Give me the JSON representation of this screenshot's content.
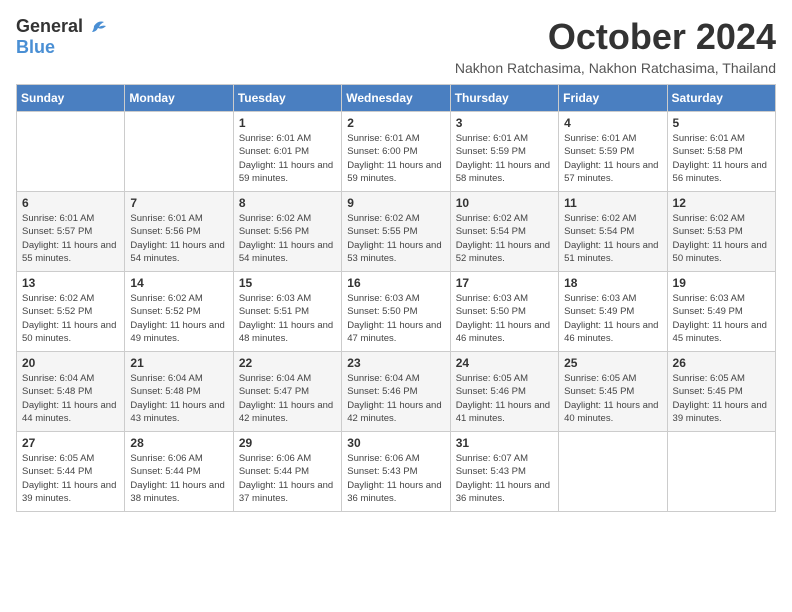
{
  "header": {
    "logo_general": "General",
    "logo_blue": "Blue",
    "month_title": "October 2024",
    "subtitle": "Nakhon Ratchasima, Nakhon Ratchasima, Thailand"
  },
  "weekdays": [
    "Sunday",
    "Monday",
    "Tuesday",
    "Wednesday",
    "Thursday",
    "Friday",
    "Saturday"
  ],
  "weeks": [
    [
      {
        "day": "",
        "info": ""
      },
      {
        "day": "",
        "info": ""
      },
      {
        "day": "1",
        "info": "Sunrise: 6:01 AM\nSunset: 6:01 PM\nDaylight: 11 hours and 59 minutes."
      },
      {
        "day": "2",
        "info": "Sunrise: 6:01 AM\nSunset: 6:00 PM\nDaylight: 11 hours and 59 minutes."
      },
      {
        "day": "3",
        "info": "Sunrise: 6:01 AM\nSunset: 5:59 PM\nDaylight: 11 hours and 58 minutes."
      },
      {
        "day": "4",
        "info": "Sunrise: 6:01 AM\nSunset: 5:59 PM\nDaylight: 11 hours and 57 minutes."
      },
      {
        "day": "5",
        "info": "Sunrise: 6:01 AM\nSunset: 5:58 PM\nDaylight: 11 hours and 56 minutes."
      }
    ],
    [
      {
        "day": "6",
        "info": "Sunrise: 6:01 AM\nSunset: 5:57 PM\nDaylight: 11 hours and 55 minutes."
      },
      {
        "day": "7",
        "info": "Sunrise: 6:01 AM\nSunset: 5:56 PM\nDaylight: 11 hours and 54 minutes."
      },
      {
        "day": "8",
        "info": "Sunrise: 6:02 AM\nSunset: 5:56 PM\nDaylight: 11 hours and 54 minutes."
      },
      {
        "day": "9",
        "info": "Sunrise: 6:02 AM\nSunset: 5:55 PM\nDaylight: 11 hours and 53 minutes."
      },
      {
        "day": "10",
        "info": "Sunrise: 6:02 AM\nSunset: 5:54 PM\nDaylight: 11 hours and 52 minutes."
      },
      {
        "day": "11",
        "info": "Sunrise: 6:02 AM\nSunset: 5:54 PM\nDaylight: 11 hours and 51 minutes."
      },
      {
        "day": "12",
        "info": "Sunrise: 6:02 AM\nSunset: 5:53 PM\nDaylight: 11 hours and 50 minutes."
      }
    ],
    [
      {
        "day": "13",
        "info": "Sunrise: 6:02 AM\nSunset: 5:52 PM\nDaylight: 11 hours and 50 minutes."
      },
      {
        "day": "14",
        "info": "Sunrise: 6:02 AM\nSunset: 5:52 PM\nDaylight: 11 hours and 49 minutes."
      },
      {
        "day": "15",
        "info": "Sunrise: 6:03 AM\nSunset: 5:51 PM\nDaylight: 11 hours and 48 minutes."
      },
      {
        "day": "16",
        "info": "Sunrise: 6:03 AM\nSunset: 5:50 PM\nDaylight: 11 hours and 47 minutes."
      },
      {
        "day": "17",
        "info": "Sunrise: 6:03 AM\nSunset: 5:50 PM\nDaylight: 11 hours and 46 minutes."
      },
      {
        "day": "18",
        "info": "Sunrise: 6:03 AM\nSunset: 5:49 PM\nDaylight: 11 hours and 46 minutes."
      },
      {
        "day": "19",
        "info": "Sunrise: 6:03 AM\nSunset: 5:49 PM\nDaylight: 11 hours and 45 minutes."
      }
    ],
    [
      {
        "day": "20",
        "info": "Sunrise: 6:04 AM\nSunset: 5:48 PM\nDaylight: 11 hours and 44 minutes."
      },
      {
        "day": "21",
        "info": "Sunrise: 6:04 AM\nSunset: 5:48 PM\nDaylight: 11 hours and 43 minutes."
      },
      {
        "day": "22",
        "info": "Sunrise: 6:04 AM\nSunset: 5:47 PM\nDaylight: 11 hours and 42 minutes."
      },
      {
        "day": "23",
        "info": "Sunrise: 6:04 AM\nSunset: 5:46 PM\nDaylight: 11 hours and 42 minutes."
      },
      {
        "day": "24",
        "info": "Sunrise: 6:05 AM\nSunset: 5:46 PM\nDaylight: 11 hours and 41 minutes."
      },
      {
        "day": "25",
        "info": "Sunrise: 6:05 AM\nSunset: 5:45 PM\nDaylight: 11 hours and 40 minutes."
      },
      {
        "day": "26",
        "info": "Sunrise: 6:05 AM\nSunset: 5:45 PM\nDaylight: 11 hours and 39 minutes."
      }
    ],
    [
      {
        "day": "27",
        "info": "Sunrise: 6:05 AM\nSunset: 5:44 PM\nDaylight: 11 hours and 39 minutes."
      },
      {
        "day": "28",
        "info": "Sunrise: 6:06 AM\nSunset: 5:44 PM\nDaylight: 11 hours and 38 minutes."
      },
      {
        "day": "29",
        "info": "Sunrise: 6:06 AM\nSunset: 5:44 PM\nDaylight: 11 hours and 37 minutes."
      },
      {
        "day": "30",
        "info": "Sunrise: 6:06 AM\nSunset: 5:43 PM\nDaylight: 11 hours and 36 minutes."
      },
      {
        "day": "31",
        "info": "Sunrise: 6:07 AM\nSunset: 5:43 PM\nDaylight: 11 hours and 36 minutes."
      },
      {
        "day": "",
        "info": ""
      },
      {
        "day": "",
        "info": ""
      }
    ]
  ]
}
